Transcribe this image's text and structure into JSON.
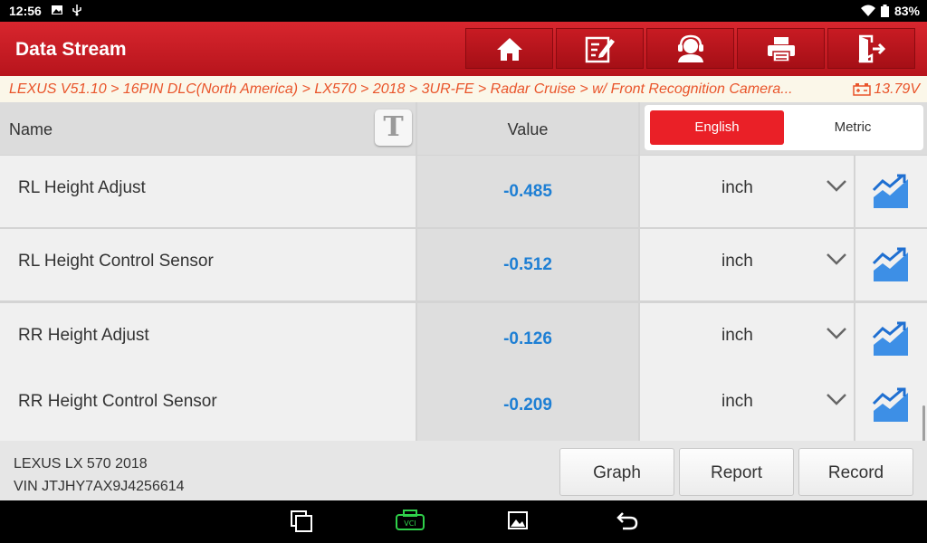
{
  "status": {
    "time": "12:56",
    "battery": "83%"
  },
  "header": {
    "title": "Data Stream",
    "buttons": [
      {
        "icon": "home-icon"
      },
      {
        "icon": "edit-icon"
      },
      {
        "icon": "support-icon"
      },
      {
        "icon": "print-icon"
      },
      {
        "icon": "exit-icon"
      }
    ]
  },
  "breadcrumb": {
    "path": "LEXUS V51.10 > 16PIN DLC(North America) > LX570 > 2018 > 3UR-FE > Radar Cruise > w/ Front Recognition Camera...",
    "voltage": "13.79V"
  },
  "table": {
    "headers": {
      "name": "Name",
      "value": "Value"
    },
    "units_toggle": {
      "english": "English",
      "metric": "Metric",
      "selected": "English"
    },
    "rows": [
      {
        "name": "RL Height Adjust",
        "value": "-0.485",
        "unit": "inch"
      },
      {
        "name": "RL Height Control Sensor",
        "value": "-0.512",
        "unit": "inch"
      },
      {
        "name": "RR Height Adjust",
        "value": "-0.126",
        "unit": "inch"
      },
      {
        "name": "RR Height Control Sensor",
        "value": "-0.209",
        "unit": "inch"
      }
    ]
  },
  "footer": {
    "vehicle": "LEXUS LX 570 2018",
    "vin": "VIN JTJHY7AX9J4256614",
    "buttons": {
      "graph": "Graph",
      "report": "Report",
      "record": "Record"
    }
  },
  "colors": {
    "accent": "#d8262e",
    "value_blue": "#1e7fd4",
    "breadcrumb_orange": "#e9542a"
  }
}
